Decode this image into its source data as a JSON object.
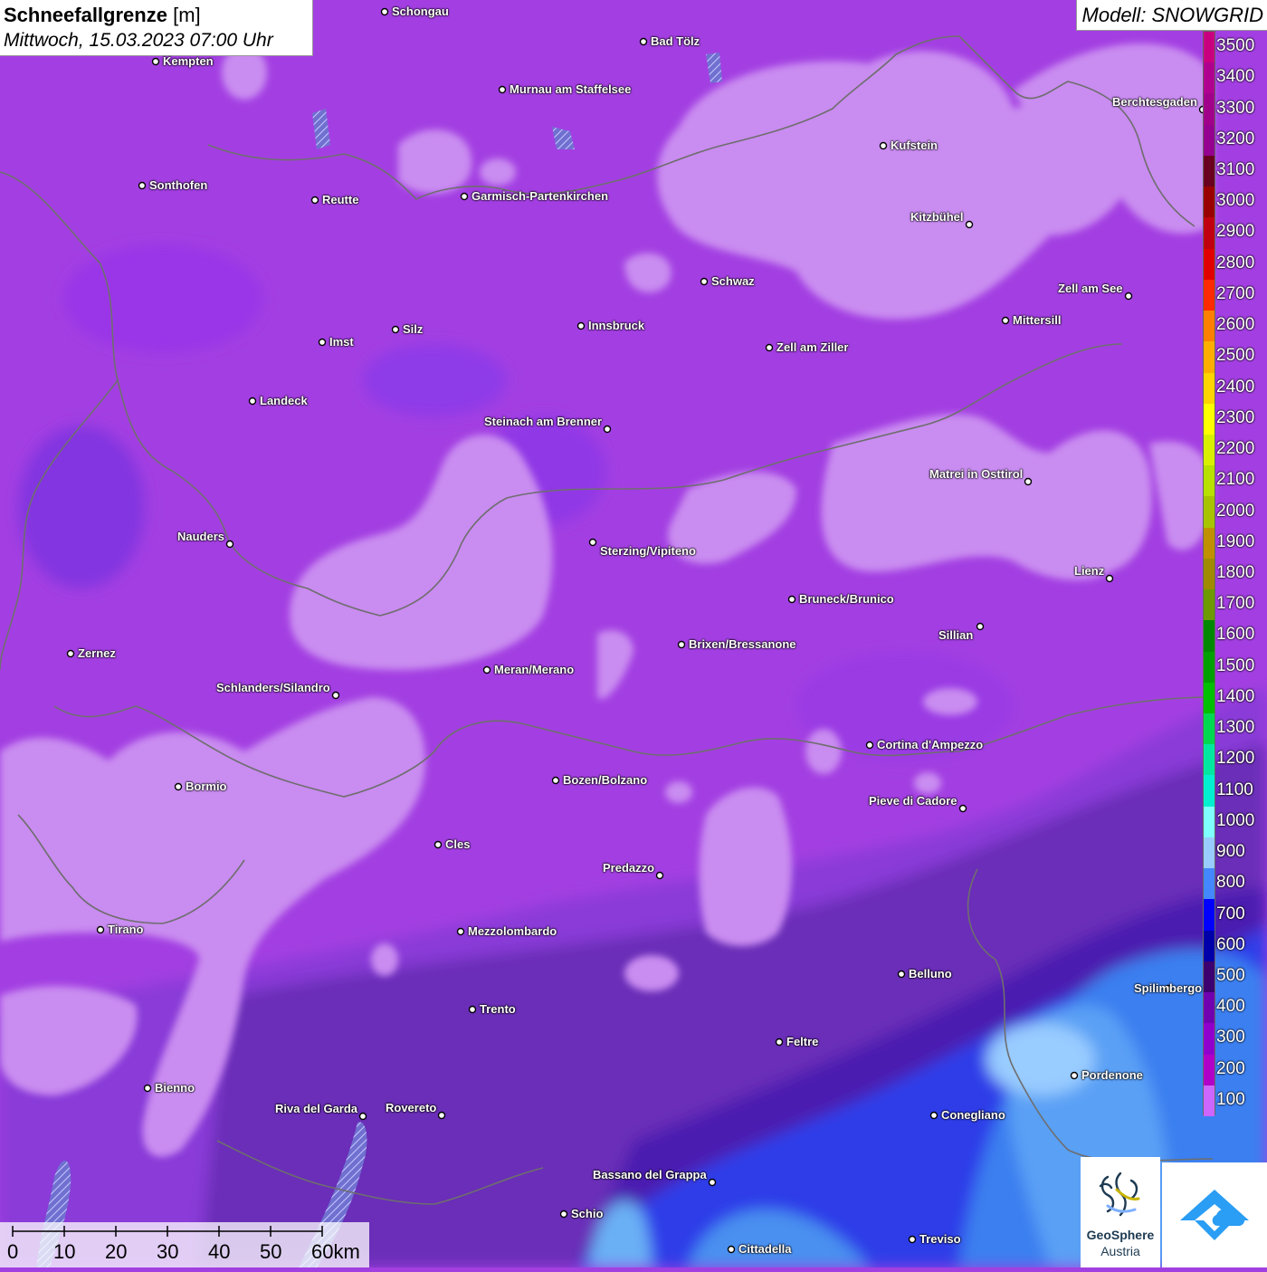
{
  "title": {
    "param": "Schneefallgrenze",
    "unit": "[m]",
    "datetime": "Mittwoch, 15.03.2023 07:00 Uhr"
  },
  "model": "Modell: SNOWGRID",
  "legend": {
    "values": [
      "3500",
      "3400",
      "3300",
      "3200",
      "3100",
      "3000",
      "2900",
      "2800",
      "2700",
      "2600",
      "2500",
      "2400",
      "2300",
      "2200",
      "2100",
      "2000",
      "1900",
      "1800",
      "1700",
      "1600",
      "1500",
      "1400",
      "1300",
      "1200",
      "1100",
      "1000",
      "900",
      "800",
      "700",
      "600",
      "500",
      "400",
      "300",
      "200",
      "100"
    ],
    "colors": [
      "#c8007f",
      "#b00090",
      "#a0008a",
      "#950090",
      "#6a0020",
      "#990000",
      "#c00010",
      "#e00000",
      "#ff2a00",
      "#ff7f00",
      "#ffae00",
      "#ffd400",
      "#ffff00",
      "#d8f000",
      "#b8e000",
      "#a8c400",
      "#c09000",
      "#a08a00",
      "#6c9a00",
      "#008800",
      "#00a000",
      "#00c000",
      "#00d850",
      "#00e8a0",
      "#00f0d0",
      "#80ffff",
      "#99ccff",
      "#4488ff",
      "#0000ff",
      "#0000aa",
      "#3c0070",
      "#7000b0",
      "#9000cc",
      "#b000c8",
      "#cc66ff"
    ]
  },
  "cities": [
    {
      "name": "Schongau",
      "dot": [
        425,
        13
      ],
      "label": "r"
    },
    {
      "name": "Bad Tölz",
      "dot": [
        711,
        46
      ],
      "label": "r"
    },
    {
      "name": "Kempten",
      "dot": [
        172,
        68
      ],
      "label": "r"
    },
    {
      "name": "Murnau am Staffelsee",
      "dot": [
        555,
        99
      ],
      "label": "r"
    },
    {
      "name": "Berchtesgaden",
      "dot": [
        1329,
        121
      ],
      "label": "l"
    },
    {
      "name": "Kufstein",
      "dot": [
        976,
        161
      ],
      "label": "r"
    },
    {
      "name": "Sonthofen",
      "dot": [
        157,
        205
      ],
      "label": "r"
    },
    {
      "name": "Reutte",
      "dot": [
        348,
        221
      ],
      "label": "r"
    },
    {
      "name": "Garmisch-Partenkirchen",
      "dot": [
        513,
        217
      ],
      "label": "r"
    },
    {
      "name": "Kitzbühel",
      "dot": [
        1071,
        248
      ],
      "label": "l"
    },
    {
      "name": "Schwaz",
      "dot": [
        778,
        311
      ],
      "label": "r"
    },
    {
      "name": "Zell am See",
      "dot": [
        1247,
        327
      ],
      "label": "l"
    },
    {
      "name": "Mittersill",
      "dot": [
        1111,
        354
      ],
      "label": "r"
    },
    {
      "name": "Innsbruck",
      "dot": [
        642,
        360
      ],
      "label": "r"
    },
    {
      "name": "Imst",
      "dot": [
        356,
        378
      ],
      "label": "r"
    },
    {
      "name": "Silz",
      "dot": [
        437,
        364
      ],
      "label": "r"
    },
    {
      "name": "Zell am Ziller",
      "dot": [
        850,
        384
      ],
      "label": "r"
    },
    {
      "name": "Landeck",
      "dot": [
        279,
        443
      ],
      "label": "r"
    },
    {
      "name": "Steinach am Brenner",
      "dot": [
        671,
        474
      ],
      "label": "l"
    },
    {
      "name": "Matrei in Osttirol",
      "dot": [
        1136,
        532
      ],
      "label": "l"
    },
    {
      "name": "Nauders",
      "dot": [
        254,
        601
      ],
      "label": "l"
    },
    {
      "name": "Sterzing/Vipiteno",
      "dot": [
        655,
        599
      ],
      "label": "r2"
    },
    {
      "name": "Lienz",
      "dot": [
        1226,
        639
      ],
      "label": "l"
    },
    {
      "name": "Bruneck/Brunico",
      "dot": [
        875,
        662
      ],
      "label": "r"
    },
    {
      "name": "Sillian",
      "dot": [
        1083,
        692
      ],
      "label": "l2"
    },
    {
      "name": "Brixen/Bressanone",
      "dot": [
        753,
        712
      ],
      "label": "r"
    },
    {
      "name": "Zernez",
      "dot": [
        78,
        722
      ],
      "label": "r"
    },
    {
      "name": "Meran/Merano",
      "dot": [
        538,
        740
      ],
      "label": "r"
    },
    {
      "name": "Schlanders/Silandro",
      "dot": [
        371,
        768
      ],
      "label": "l"
    },
    {
      "name": "Cortina d'Ampezzo",
      "dot": [
        961,
        823
      ],
      "label": "r"
    },
    {
      "name": "Bozen/Bolzano",
      "dot": [
        614,
        862
      ],
      "label": "r"
    },
    {
      "name": "Bormio",
      "dot": [
        197,
        869
      ],
      "label": "r"
    },
    {
      "name": "Pieve di Cadore",
      "dot": [
        1064,
        893
      ],
      "label": "l"
    },
    {
      "name": "Cles",
      "dot": [
        484,
        933
      ],
      "label": "r"
    },
    {
      "name": "Predazzo",
      "dot": [
        729,
        967
      ],
      "label": "l"
    },
    {
      "name": "Tirano",
      "dot": [
        111,
        1027
      ],
      "label": "r"
    },
    {
      "name": "Mezzolombardo",
      "dot": [
        509,
        1029
      ],
      "label": "r"
    },
    {
      "name": "Belluno",
      "dot": [
        996,
        1076
      ],
      "label": "r"
    },
    {
      "name": "Spilimbergo",
      "dot": [
        1291,
        1092
      ],
      "label": "r"
    },
    {
      "name": "Trento",
      "dot": [
        522,
        1115
      ],
      "label": "r"
    },
    {
      "name": "Feltre",
      "dot": [
        861,
        1151
      ],
      "label": "r"
    },
    {
      "name": "Pordenone",
      "dot": [
        1187,
        1188
      ],
      "label": "r"
    },
    {
      "name": "Bienno",
      "dot": [
        163,
        1202
      ],
      "label": "r"
    },
    {
      "name": "Riva del Garda",
      "dot": [
        401,
        1233
      ],
      "label": "l"
    },
    {
      "name": "Rovereto",
      "dot": [
        488,
        1232
      ],
      "label": "l"
    },
    {
      "name": "Conegliano",
      "dot": [
        1032,
        1232
      ],
      "label": "r"
    },
    {
      "name": "Bassano del Grappa",
      "dot": [
        787,
        1306
      ],
      "label": "l"
    },
    {
      "name": "Schio",
      "dot": [
        623,
        1341
      ],
      "label": "r"
    },
    {
      "name": "Treviso",
      "dot": [
        1008,
        1369
      ],
      "label": "r"
    },
    {
      "name": "Cittadella",
      "dot": [
        808,
        1380
      ],
      "label": "r"
    }
  ],
  "scalebar": {
    "ticks": [
      "0",
      "10",
      "20",
      "30",
      "40",
      "50",
      "60km"
    ]
  },
  "branding": {
    "line1": "GeoSphere",
    "line2": "Austria"
  }
}
